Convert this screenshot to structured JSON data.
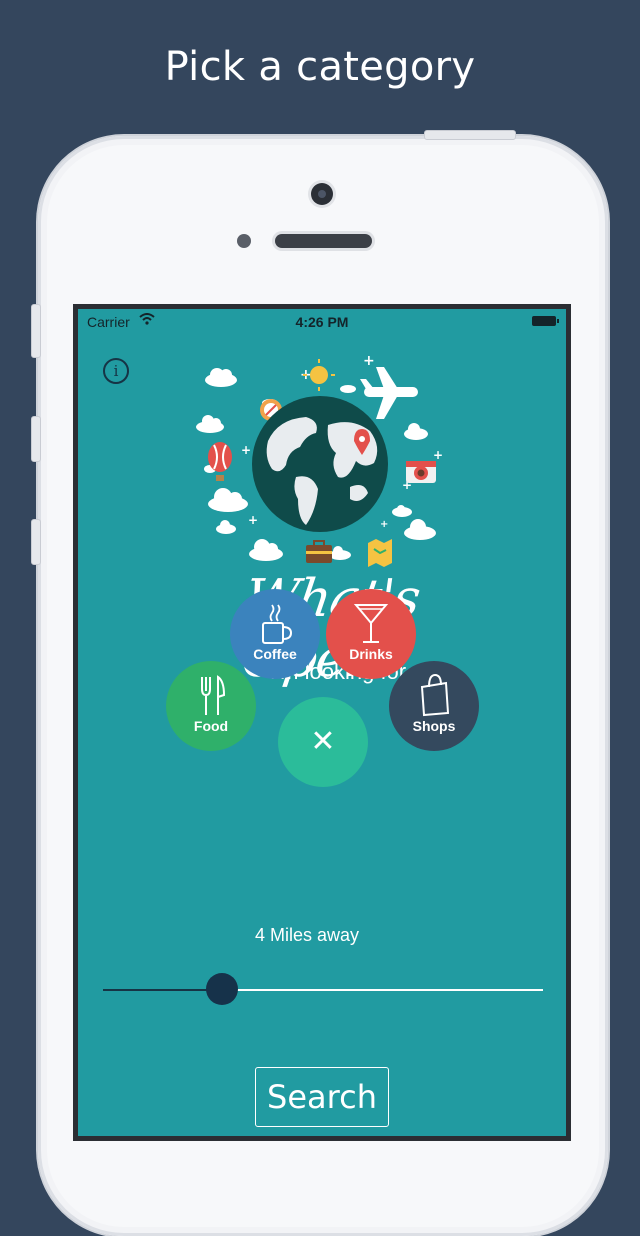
{
  "headline": "Pick a category",
  "status_bar": {
    "carrier": "Carrier",
    "time": "4:26 PM"
  },
  "app": {
    "title": "What's Open?",
    "subtitle": "I'm looking for",
    "categories": [
      {
        "label": "Coffee",
        "icon": "coffee-cup-icon",
        "color": "#3b83bd"
      },
      {
        "label": "Drinks",
        "icon": "cocktail-glass-icon",
        "color": "#e3504b"
      },
      {
        "label": "Food",
        "icon": "fork-knife-icon",
        "color": "#2fb06a"
      },
      {
        "label": "Shops",
        "icon": "shopping-bag-icon",
        "color": "#34495e"
      }
    ],
    "close_icon": "close-icon",
    "close_symbol": "✕",
    "distance_label": "4 Miles away",
    "distance_slider": {
      "value": 0.27
    },
    "search_label": "Search"
  },
  "colors": {
    "background": "#34465d",
    "screen": "#219ba1",
    "close_bubble": "#2bbc9a",
    "globe": "#0f4b4a"
  }
}
